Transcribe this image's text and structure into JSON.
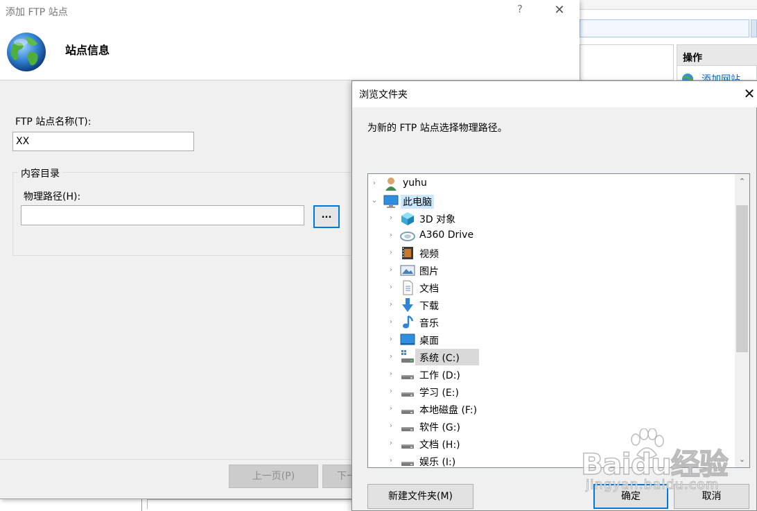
{
  "background_window": {
    "actions_header": "操作",
    "add_site_link": "添加网站"
  },
  "ftp_wizard": {
    "title": "添加 FTP 站点",
    "help_symbol": "?",
    "close_symbol": "✕",
    "step_heading": "站点信息",
    "site_name_label": "FTP 站点名称(T):",
    "site_name_value": "XX",
    "content_group_title": "内容目录",
    "physical_path_label": "物理路径(H):",
    "physical_path_value": "",
    "browse_button_label": "...",
    "prev_button": "上一页(P)",
    "next_button": "下一"
  },
  "browse_dialog": {
    "title": "浏览文件夹",
    "close_symbol": "✕",
    "description": "为新的 FTP 站点选择物理路径。",
    "tree": [
      {
        "label": "yuhu",
        "icon": "user-folder-icon",
        "level": 0,
        "expanded": false
      },
      {
        "label": "此电脑",
        "icon": "this-pc-icon",
        "level": 0,
        "expanded": true,
        "selected": "strong"
      },
      {
        "label": "3D 对象",
        "icon": "3d-objects-icon",
        "level": 1,
        "expanded": false
      },
      {
        "label": "A360 Drive",
        "icon": "a360-drive-icon",
        "level": 1,
        "expanded": false
      },
      {
        "label": "视频",
        "icon": "videos-icon",
        "level": 1,
        "expanded": false
      },
      {
        "label": "图片",
        "icon": "pictures-icon",
        "level": 1,
        "expanded": false
      },
      {
        "label": "文档",
        "icon": "documents-icon",
        "level": 1,
        "expanded": false
      },
      {
        "label": "下载",
        "icon": "downloads-icon",
        "level": 1,
        "expanded": false
      },
      {
        "label": "音乐",
        "icon": "music-icon",
        "level": 1,
        "expanded": false
      },
      {
        "label": "桌面",
        "icon": "desktop-icon",
        "level": 1,
        "expanded": false
      },
      {
        "label": "系统 (C:)",
        "icon": "system-drive-icon",
        "level": 1,
        "expanded": false,
        "selected": "soft"
      },
      {
        "label": "工作 (D:)",
        "icon": "drive-icon",
        "level": 1,
        "expanded": false
      },
      {
        "label": "学习 (E:)",
        "icon": "drive-icon",
        "level": 1,
        "expanded": false
      },
      {
        "label": "本地磁盘 (F:)",
        "icon": "drive-icon",
        "level": 1,
        "expanded": false
      },
      {
        "label": "软件 (G:)",
        "icon": "drive-icon",
        "level": 1,
        "expanded": false
      },
      {
        "label": "文档 (H:)",
        "icon": "drive-icon",
        "level": 1,
        "expanded": false
      },
      {
        "label": "娱乐 (I:)",
        "icon": "drive-icon",
        "level": 1,
        "expanded": false
      }
    ],
    "new_folder_button": "新建文件夹(M)",
    "ok_button": "确定",
    "cancel_button": "取消"
  },
  "watermark": {
    "logo_text": "Baidu经验",
    "url": "jingyan.baidu.com"
  }
}
